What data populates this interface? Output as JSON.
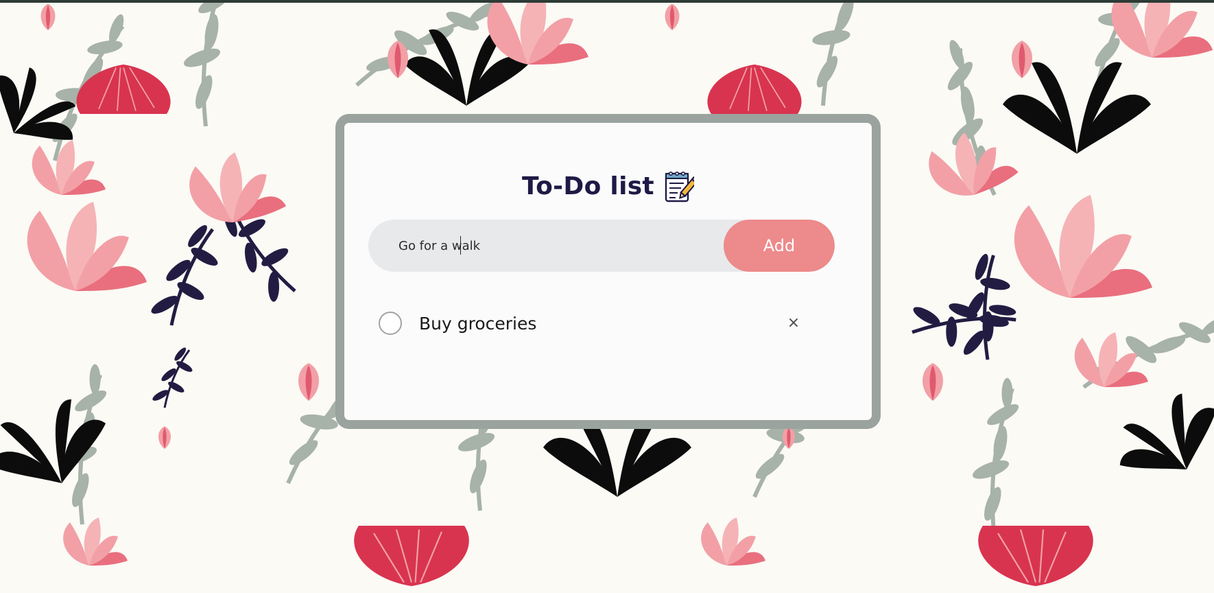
{
  "app": {
    "title": "To-Do list",
    "title_icon": "notepad-pencil-icon"
  },
  "input": {
    "value": "Go for a walk",
    "placeholder": ""
  },
  "add_button": {
    "label": "Add"
  },
  "tasks": [
    {
      "text": "Buy groceries",
      "checked": false,
      "delete_icon": "close-icon",
      "delete_label": "×"
    }
  ],
  "colors": {
    "card_border": "#9aa39e",
    "card_background": "#fbfbfc",
    "title": "#1e1a45",
    "input_background": "#e8e9eb",
    "button": "#ed8a8b",
    "button_text": "#ffffff",
    "pattern_pink": "#f2a0a6",
    "pattern_crimson": "#d8344f",
    "pattern_sage": "#a7b2a8",
    "pattern_navy": "#231c42",
    "pattern_black": "#0c0c0c"
  }
}
